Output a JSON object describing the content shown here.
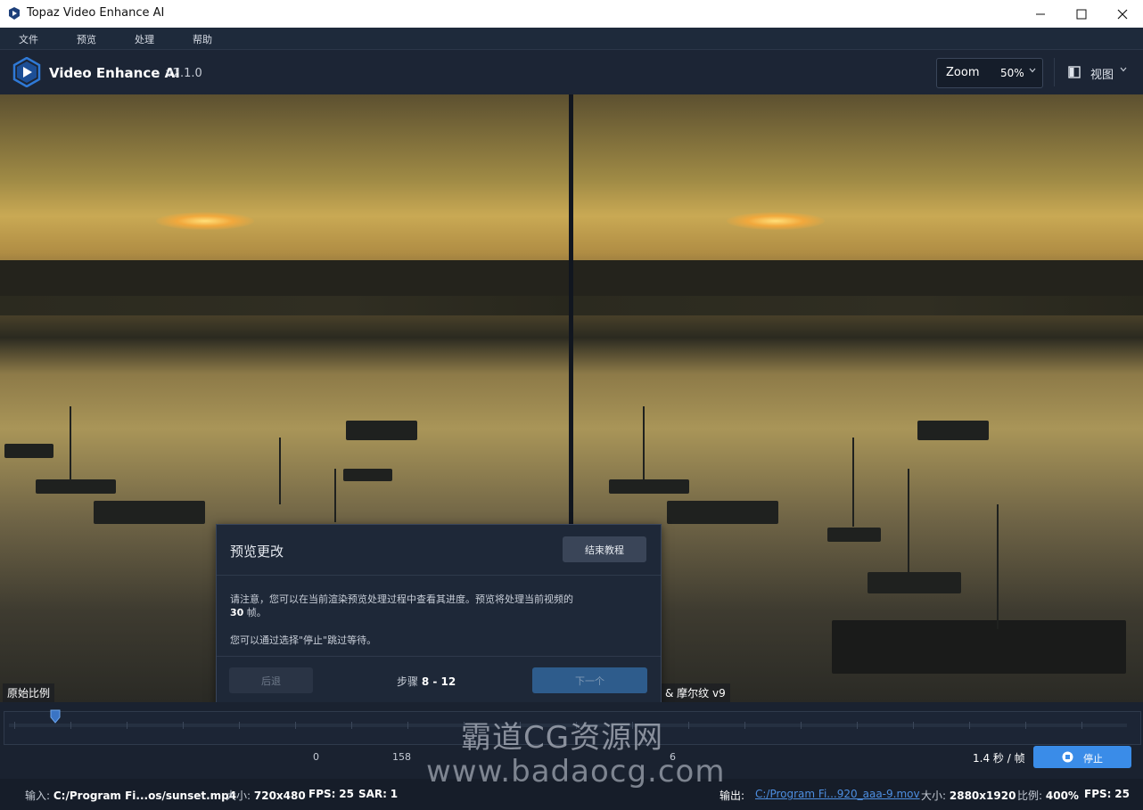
{
  "window": {
    "title": "Topaz Video Enhance AI",
    "minimize": "—",
    "maximize": "☐",
    "close": "✕"
  },
  "menu": [
    "文件",
    "预览",
    "处理",
    "帮助"
  ],
  "header": {
    "app_name": "Video Enhance AI",
    "version": "v2.1.0",
    "zoom_label": "Zoom",
    "zoom_value": "50%",
    "view_label": "视图"
  },
  "preview": {
    "left_label": "原始比例",
    "right_label": "& 摩尔纹 v9"
  },
  "dialog": {
    "title": "预览更改",
    "end_button": "结束教程",
    "para1_text": "请注意，您可以在当前渲染预览处理过程中查看其进度。预览将处理当前视频的",
    "para1_frames": "30",
    "para1_suffix": " 帧。",
    "para2": "您可以通过选择\"停止\"跳过等待。",
    "back_button": "后退",
    "step_label": "步骤",
    "step_value": "8 - 12",
    "next_button": "下一个"
  },
  "timeline": {
    "markers": [
      "0",
      "158",
      "6"
    ],
    "rate": "1.4 秒 / 帧",
    "stop_button": "停止"
  },
  "status": {
    "input_label": "输入:",
    "input_path": "C:/Program Fi...os/sunset.mp4",
    "in_size_label": "大小:",
    "in_size": "720x480",
    "in_fps_label": "FPS:",
    "in_fps": "25",
    "sar_label": "SAR:",
    "sar": "1",
    "output_label": "输出:",
    "output_path": "C:/Program Fi...920_aaa-9.mov",
    "out_size_label": "大小:",
    "out_size": "2880x1920",
    "scale_label": "比例:",
    "scale": "400%",
    "out_fps_label": "FPS:",
    "out_fps": "25"
  },
  "watermark": {
    "line1": "霸道CG资源网",
    "line2": "www.badaocg.com"
  },
  "colors": {
    "accent": "#3a8ce8",
    "background": "#1b2433",
    "link": "#4d8ee0"
  }
}
